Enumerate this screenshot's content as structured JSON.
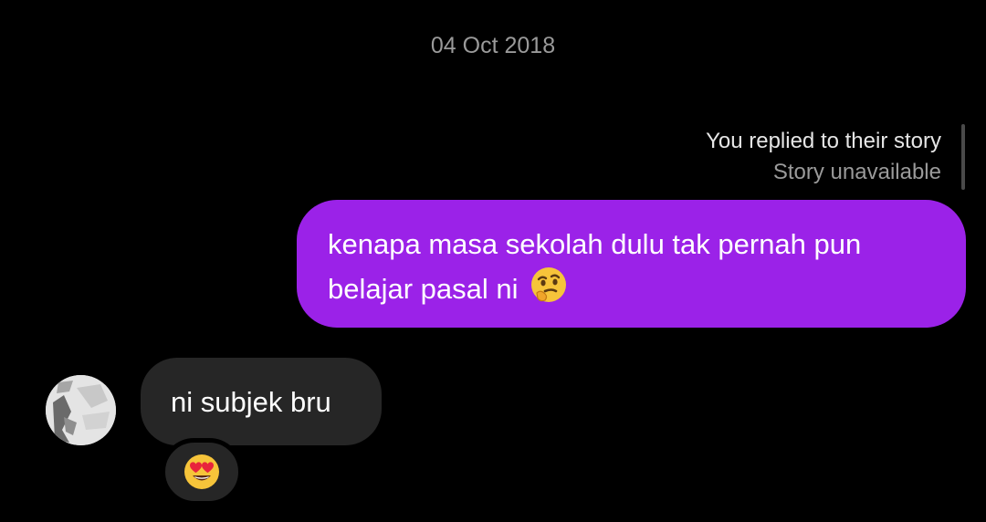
{
  "thread": {
    "date": "04 Oct 2018"
  },
  "story_reply": {
    "label": "You replied to their story",
    "status": "Story unavailable"
  },
  "messages": [
    {
      "direction": "outgoing",
      "text": "kenapa masa sekolah dulu tak pernah pun belajar pasal ni",
      "emoji": "thinking-face-emoji",
      "bubble_color": "#9b22e8"
    },
    {
      "direction": "incoming",
      "text": "ni subjek bru",
      "bubble_color": "#262626",
      "reaction": "heart-eyes-emoji"
    }
  ],
  "colors": {
    "background": "#000000",
    "meta_text": "#9a9a9a",
    "outgoing_bubble": "#9b22e8",
    "incoming_bubble": "#262626"
  }
}
